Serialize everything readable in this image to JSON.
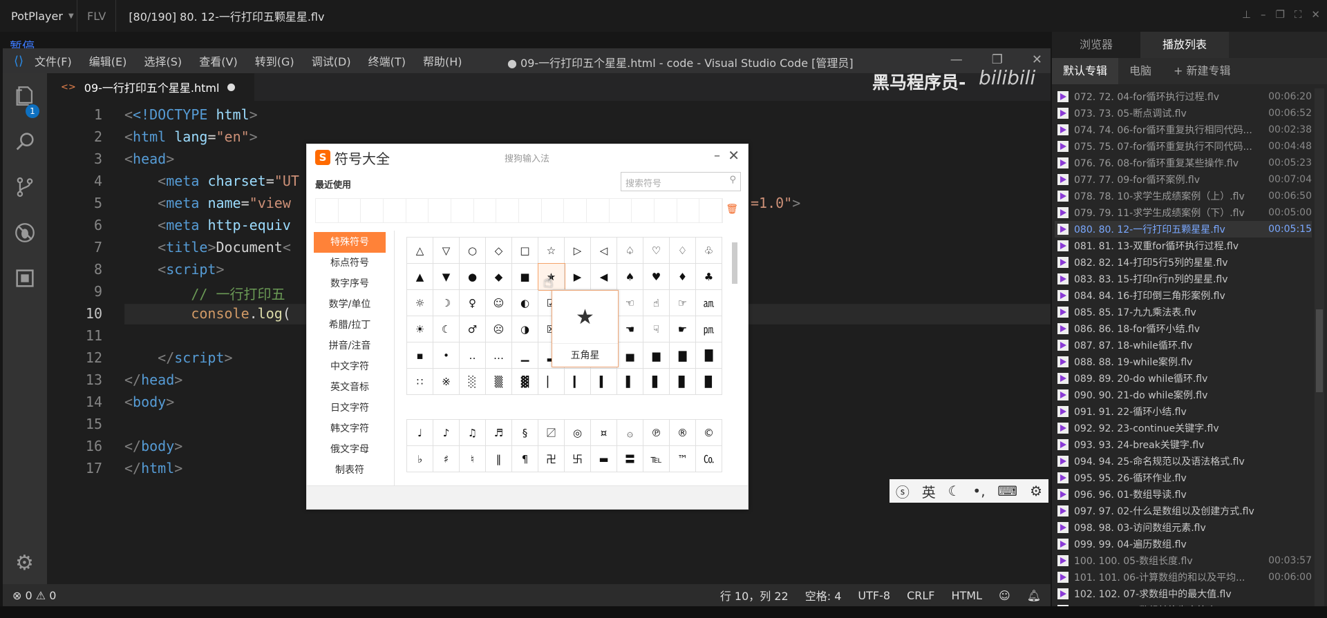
{
  "player": {
    "name": "PotPlayer",
    "format": "FLV",
    "file": "[80/190] 80. 12-一行打印五颗星星.flv",
    "status": "暂停",
    "controls": [
      "pin-icon",
      "minimize-icon",
      "restore-icon",
      "fullscreen-icon",
      "close-icon"
    ]
  },
  "vscode": {
    "title": "● 09-一行打印五个星星.html - code - Visual Studio Code [管理员]",
    "menu": [
      "文件(F)",
      "编辑(E)",
      "选择(S)",
      "查看(V)",
      "转到(G)",
      "调试(D)",
      "终端(T)",
      "帮助(H)"
    ],
    "tab": "09-一行打印五个星星.html",
    "scm_badge": "1",
    "line_numbers": [
      "1",
      "2",
      "3",
      "4",
      "5",
      "6",
      "7",
      "8",
      "9",
      "10",
      "11",
      "12",
      "13",
      "14",
      "15",
      "16",
      "17"
    ],
    "code": {
      "l1a": "<!DOCTYPE",
      "l1b": "html",
      "l2a": "html",
      "l2b": "lang",
      "l2c": "\"en\"",
      "l3": "head",
      "l4a": "meta",
      "l4b": "charset",
      "l4c": "\"UT",
      "l5a": "meta",
      "l5b": "name",
      "l5c": "\"view",
      "l5d": "=1.0\"",
      "l6a": "meta",
      "l6b": "http-equiv",
      "l7a": "title",
      "l7b": "Document",
      "l8": "script",
      "l9": "// 一行打印五",
      "l10a": "console",
      ".": ".",
      "l10b": "log",
      "l12": "script",
      "l13": "head",
      "l14": "body",
      "l16": "body",
      "l17": "html"
    },
    "status": {
      "errors": "0",
      "warnings": "0",
      "position": "行 10，列 22",
      "indent": "空格: 4",
      "encoding": "UTF-8",
      "eol": "CRLF",
      "language": "HTML"
    }
  },
  "watermark": {
    "text": "黑马程序员-",
    "bili": "bilibili"
  },
  "sogou": {
    "title": "符号大全",
    "subtitle": "搜狗输入法",
    "recent": "最近使用",
    "search_placeholder": "搜索符号",
    "categories": [
      "特殊符号",
      "标点符号",
      "数字序号",
      "数学/单位",
      "希腊/拉丁",
      "拼音/注音",
      "中文字符",
      "英文音标",
      "日文字符",
      "韩文字符",
      "俄文字母",
      "制表符"
    ],
    "grid1": [
      "△",
      "▽",
      "○",
      "◇",
      "□",
      "☆",
      "▷",
      "◁",
      "♤",
      "♡",
      "♢",
      "♧",
      "▲",
      "▼",
      "●",
      "◆",
      "■",
      "★",
      "▶",
      "◀",
      "♠",
      "♥",
      "♦",
      "♣",
      "☼",
      "☽",
      "♀",
      "☺",
      "◐",
      "☑",
      "√",
      "✔",
      "☜",
      "☝",
      "☞",
      "㏂",
      "☀",
      "☾",
      "♂",
      "☹",
      "◑",
      "☒",
      "",
      "",
      "☚",
      "☟",
      "☛",
      "㏘",
      "▪",
      "•",
      "‥",
      "…",
      "▁",
      "▂",
      "▃",
      "▄",
      "▅",
      "▆",
      "▇",
      "█",
      "∷",
      "※",
      "░",
      "▒",
      "▓",
      "▏",
      "▎",
      "▍",
      "▌",
      "▋",
      "▊",
      "▉"
    ],
    "grid2": [
      "♩",
      "♪",
      "♫",
      "♬",
      "§",
      "〼",
      "◎",
      "¤",
      "۞",
      "℗",
      "®",
      "©",
      "♭",
      "♯",
      "♮",
      "‖",
      "¶",
      "卍",
      "卐",
      "▬",
      "〓",
      "℡",
      "™",
      "㏇"
    ],
    "tooltip": {
      "symbol": "★",
      "name": "五角星"
    }
  },
  "ime": {
    "lang": "英",
    "icons": [
      "sogou-logo-icon",
      "moon-icon",
      "punctuation-icon",
      "keyboard-icon",
      "gear-icon"
    ]
  },
  "playlist": {
    "tabs": [
      "浏览器",
      "播放列表"
    ],
    "subtabs": [
      "默认专辑",
      "电脑",
      "+ 新建专辑"
    ],
    "items": [
      {
        "name": "072. 72. 04-for循环执行过程.flv",
        "dur": "00:06:20"
      },
      {
        "name": "073. 73. 05-断点调试.flv",
        "dur": "00:06:52"
      },
      {
        "name": "074. 74. 06-for循环重复执行相同代码...",
        "dur": "00:02:38"
      },
      {
        "name": "075. 75. 07-for循环重复执行不同代码...",
        "dur": "00:04:48"
      },
      {
        "name": "076. 76. 08-for循环重复某些操作.flv",
        "dur": "00:05:23"
      },
      {
        "name": "077. 77. 09-for循环案例.flv",
        "dur": "00:07:04"
      },
      {
        "name": "078. 78. 10-求学生成绩案例（上）.flv",
        "dur": "00:06:50"
      },
      {
        "name": "079. 79. 11-求学生成绩案例（下）.flv",
        "dur": "00:05:00"
      },
      {
        "name": "080. 80. 12-一行打印五颗星星.flv",
        "dur": "00:05:15"
      },
      {
        "name": "081. 81. 13-双重for循环执行过程.flv",
        "dur": ""
      },
      {
        "name": "082. 82. 14-打印5行5列的星星.flv",
        "dur": ""
      },
      {
        "name": "083. 83. 15-打印n行n列的星星.flv",
        "dur": ""
      },
      {
        "name": "084. 84. 16-打印倒三角形案例.flv",
        "dur": ""
      },
      {
        "name": "085. 85. 17-九九乘法表.flv",
        "dur": ""
      },
      {
        "name": "086. 86. 18-for循环小结.flv",
        "dur": ""
      },
      {
        "name": "087. 87. 18-while循环.flv",
        "dur": ""
      },
      {
        "name": "088. 88. 19-while案例.flv",
        "dur": ""
      },
      {
        "name": "089. 89. 20-do while循环.flv",
        "dur": ""
      },
      {
        "name": "090. 90. 21-do while案例.flv",
        "dur": ""
      },
      {
        "name": "091. 91. 22-循环小结.flv",
        "dur": ""
      },
      {
        "name": "092. 92. 23-continue关键字.flv",
        "dur": ""
      },
      {
        "name": "093. 93. 24-break关键字.flv",
        "dur": ""
      },
      {
        "name": "094. 94. 25-命名规范以及语法格式.flv",
        "dur": ""
      },
      {
        "name": "095. 95. 26-循环作业.flv",
        "dur": ""
      },
      {
        "name": "096. 96. 01-数组导读.flv",
        "dur": ""
      },
      {
        "name": "097. 97. 02-什么是数组以及创建方式.flv",
        "dur": ""
      },
      {
        "name": "098. 98. 03-访问数组元素.flv",
        "dur": ""
      },
      {
        "name": "099. 99. 04-遍历数组.flv",
        "dur": ""
      },
      {
        "name": "100. 100. 05-数组长度.flv",
        "dur": "00:03:57"
      },
      {
        "name": "101. 101. 06-计算数组的和以及平均...",
        "dur": "00:06:00"
      },
      {
        "name": "102. 102. 07-求数组中的最大值.flv",
        "dur": ""
      },
      {
        "name": "103. 103. 08-数组转换为字符串.flv",
        "dur": ""
      }
    ],
    "current_index": 8
  }
}
